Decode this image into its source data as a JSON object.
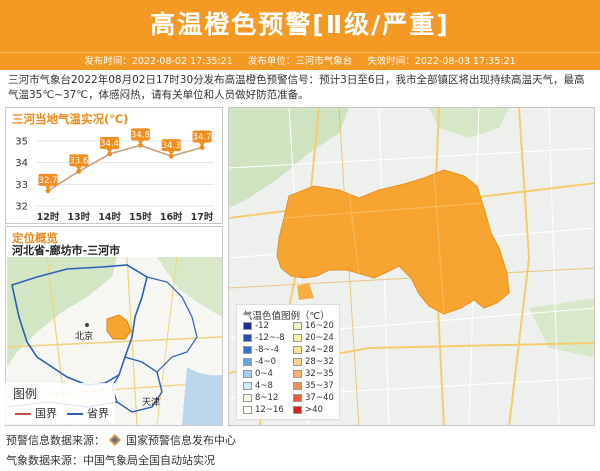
{
  "banner": {
    "title": "高温橙色预警[Ⅱ级/严重]",
    "issue_time_label": "发布时间：2022-08-02 17:35:21",
    "issuer_label": "发布单位：三河市气象台",
    "expire_label": "失效时间：2022-08-03 17:35:21",
    "color": "#f49a24"
  },
  "description": "三河市气象台2022年08月02日17时30分发布高温橙色预警信号：预计3日至6日，我市全部镇区将出现持续高温天气，最高气温35℃~37℃，体感闷热，请有关单位和人员做好防范准备。",
  "temp_panel": {
    "heading": "三河当地气温实况(℃)"
  },
  "chart_data": {
    "type": "line",
    "title": "三河当地气温实况(℃)",
    "categories": [
      "12时",
      "13时",
      "14时",
      "15时",
      "16时",
      "17时"
    ],
    "values": [
      32.7,
      33.6,
      34.4,
      34.8,
      34.3,
      34.7
    ],
    "ylim": [
      32,
      35
    ],
    "yticks": [
      "32",
      "33",
      "34",
      "35"
    ],
    "grid": true
  },
  "location_panel": {
    "heading": "定位概览",
    "region": "河北省-廊坊市-三河市",
    "map_labels": {
      "beijing": "北京",
      "tianjin": "天津"
    }
  },
  "map_legend": {
    "title": "图例",
    "items": [
      {
        "label": "国界",
        "color": "#c0504d"
      },
      {
        "label": "省界",
        "color": "#2e5fb8"
      }
    ]
  },
  "temp_legend": {
    "title": "气温色值图例（℃）",
    "items": [
      {
        "label": "-12",
        "color": "#1a2f8f"
      },
      {
        "label": "-12~-8",
        "color": "#2a4fb0"
      },
      {
        "label": "-8~-4",
        "color": "#3a6fd0"
      },
      {
        "label": "-4~0",
        "color": "#69a3e6"
      },
      {
        "label": "0~4",
        "color": "#a8cff2"
      },
      {
        "label": "4~8",
        "color": "#d3ecf7"
      },
      {
        "label": "8~12",
        "color": "#f3f9e0"
      },
      {
        "label": "12~16",
        "color": "#fdfef4"
      },
      {
        "label": "16~20",
        "color": "#e8f6c8"
      },
      {
        "label": "20~24",
        "color": "#f7f2a8"
      },
      {
        "label": "24~28",
        "color": "#fbe58a"
      },
      {
        "label": "28~32",
        "color": "#fdd18a"
      },
      {
        "label": "32~35",
        "color": "#fcb066"
      },
      {
        "label": "35~37",
        "color": "#f58e4c"
      },
      {
        "label": "37~40",
        "color": "#e95b34"
      },
      {
        "label": ">40",
        "color": "#d1201d"
      }
    ]
  },
  "footer": {
    "warning_source_label": "预警信息数据来源：",
    "warning_source": "国家预警信息发布中心",
    "weather_source_label": "气象数据来源：",
    "weather_source": "中国气象局全国自动站实况"
  },
  "colors": {
    "accent": "#f49a24",
    "warning_area": "#f7a530",
    "chart_line": "#c9a07a",
    "chart_label_bg": "#f18d1d"
  }
}
